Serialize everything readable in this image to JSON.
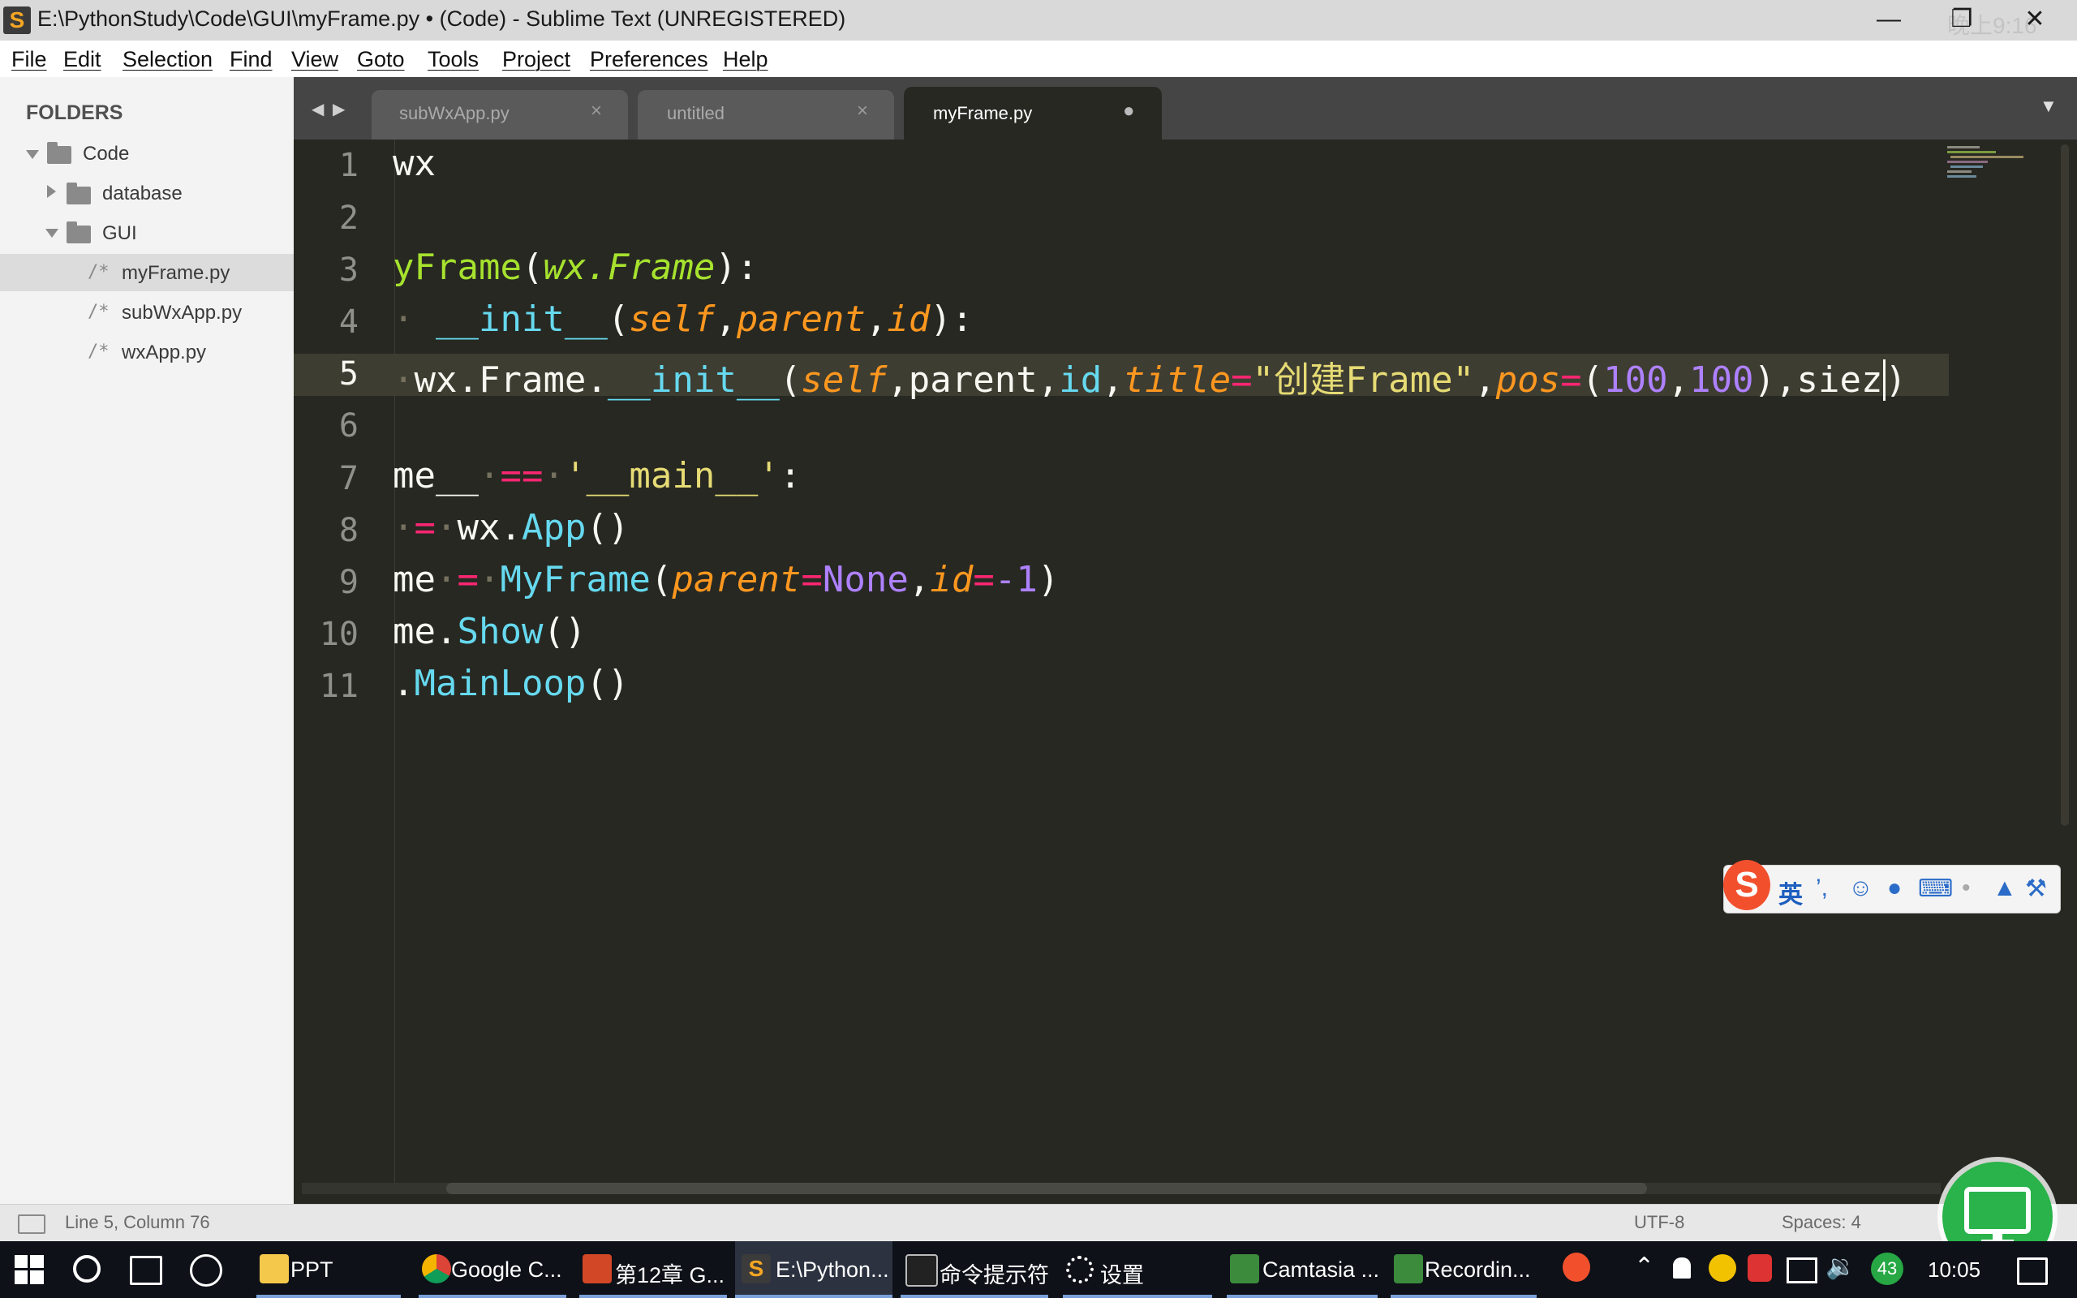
{
  "window": {
    "title": "E:\\PythonStudy\\Code\\GUI\\myFrame.py • (Code) - Sublime Text (UNREGISTERED)",
    "logo": "S",
    "ghost_time": "晚上9:16",
    "min": "—",
    "restore": "❐",
    "close": "✕"
  },
  "menu": [
    "File",
    "Edit",
    "Selection",
    "Find",
    "View",
    "Goto",
    "Tools",
    "Project",
    "Preferences",
    "Help"
  ],
  "sidebar": {
    "heading": "FOLDERS",
    "root": "Code",
    "folders": [
      "database",
      "GUI"
    ],
    "files": [
      "myFrame.py",
      "subWxApp.py",
      "wxApp.py"
    ],
    "file_marker": "/*"
  },
  "tabs": [
    {
      "label": "subWxApp.py",
      "close": "×"
    },
    {
      "label": "untitled",
      "close": "×"
    },
    {
      "label": "myFrame.py",
      "close": "●"
    }
  ],
  "tab_nav": {
    "left": "◀",
    "right": "▶",
    "overflow": "▼"
  },
  "editor": {
    "line_numbers": [
      "1",
      "2",
      "3",
      "4",
      "5",
      "6",
      "7",
      "8",
      "9",
      "10",
      "11"
    ],
    "current_line": 5,
    "lines": {
      "l1": [
        "wx"
      ],
      "l3": [
        "yFrame",
        "(",
        "wx.Frame",
        "):"
      ],
      "l4": [
        "· ",
        "__init__",
        "(",
        "self",
        ",",
        "parent",
        ",",
        "id",
        "):"
      ],
      "l5": [
        "·",
        "wx.Frame.",
        "__init__",
        "(",
        "self",
        ",parent,",
        "id",
        ",",
        "title",
        "=",
        "\"创建Frame\"",
        ",",
        "pos",
        "=",
        "(",
        "100",
        ",",
        "100",
        "),siez",
        ")"
      ],
      "l7": [
        "me__",
        "·",
        "==",
        "·",
        "'__main__'",
        ":"
      ],
      "l8": [
        "·",
        "=",
        "·",
        "wx.",
        "App",
        "()"
      ],
      "l9": [
        "me",
        "·",
        "=",
        "·",
        "MyFrame",
        "(",
        "parent",
        "=",
        "None",
        ",",
        "id",
        "=",
        "-1",
        ")"
      ],
      "l10": [
        "me.",
        "Show",
        "()"
      ],
      "l11": [
        ".",
        "MainLoop",
        "()"
      ]
    }
  },
  "ime": {
    "logo": "S",
    "mode": "英",
    "punct": "’,",
    "emoji": "☺",
    "mic": "●",
    "keyboard": "⌨",
    "user": "•",
    "skin": "▲",
    "tools": "⚒"
  },
  "statusbar": {
    "position": "Line 5, Column 76",
    "encoding": "UTF-8",
    "indent": "Spaces: 4"
  },
  "taskbar": {
    "apps": [
      "PPT",
      "Google C...",
      "第12章 G...",
      "E:\\Python...",
      "命令提示符",
      "设置",
      "Camtasia ...",
      "Recordin..."
    ],
    "badge": "43",
    "time": "10:05"
  },
  "colors": {
    "keyword": "#f92672",
    "class": "#a6e22e",
    "function": "#66d9ef",
    "param": "#fd971f",
    "string": "#e6db74",
    "number": "#ae81ff",
    "background": "#272822"
  }
}
